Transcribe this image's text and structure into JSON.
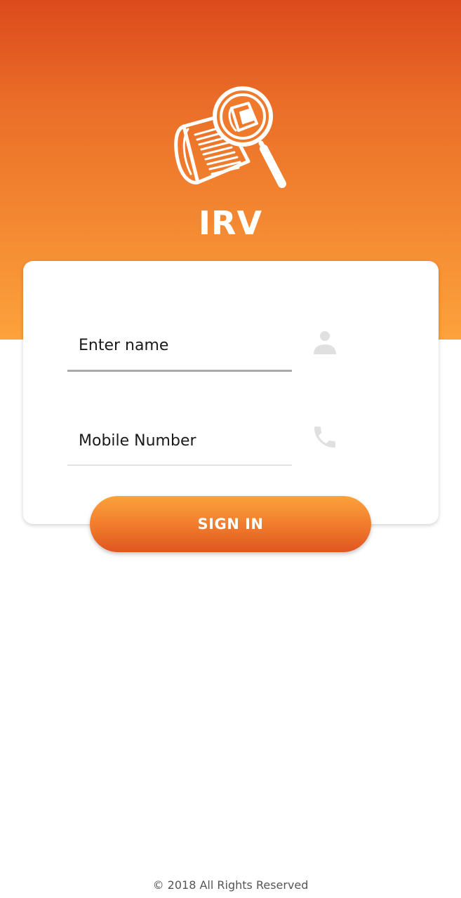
{
  "app": {
    "title": "IRV",
    "logo_icon": "newspaper-magnifier-icon"
  },
  "login_form": {
    "name_placeholder": "Enter name",
    "name_value": "",
    "name_icon": "person-icon",
    "mobile_placeholder": "Mobile Number",
    "mobile_value": "",
    "mobile_icon": "phone-icon",
    "signin_label": "SIGN IN"
  },
  "footer": {
    "copyright": "© 2018 All Rights Reserved"
  },
  "colors": {
    "brand_orange_dark": "#dc4a1c",
    "brand_orange_light": "#fca23c",
    "icon_gray": "#e0e0e0"
  }
}
